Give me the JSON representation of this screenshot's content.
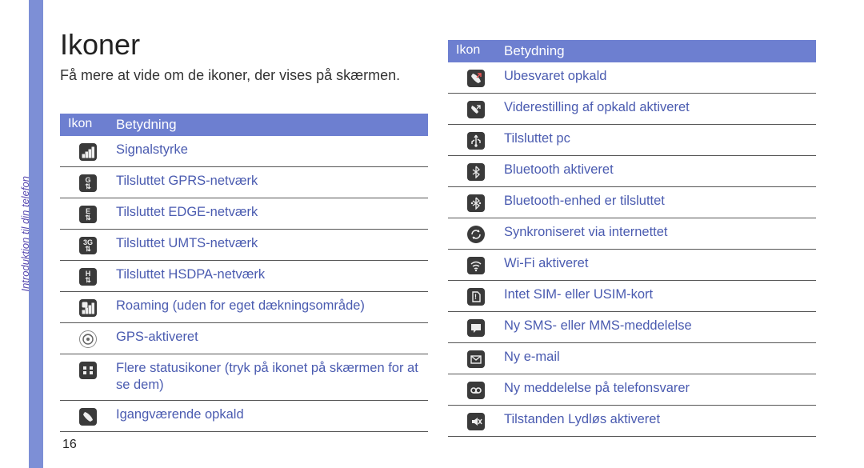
{
  "side_label": "Introduktion til din telefon",
  "heading": "Ikoner",
  "subtext": "Få mere at vide om de ikoner, der vises på skærmen.",
  "table_headers": {
    "icon": "Ikon",
    "meaning": "Betydning"
  },
  "page_number": "16",
  "left_rows": [
    {
      "icon": "signal",
      "label": "Signalstyrke"
    },
    {
      "icon": "gprs",
      "label": "Tilsluttet GPRS-netværk"
    },
    {
      "icon": "edge",
      "label": "Tilsluttet EDGE-netværk"
    },
    {
      "icon": "umts",
      "label": "Tilsluttet UMTS-netværk"
    },
    {
      "icon": "hsdpa",
      "label": "Tilsluttet HSDPA-netværk"
    },
    {
      "icon": "roam",
      "label": "Roaming (uden for eget dækningsområde)"
    },
    {
      "icon": "gps",
      "label": "GPS-aktiveret"
    },
    {
      "icon": "more",
      "label": "Flere statusikoner (tryk på ikonet på skærmen for at se dem)"
    },
    {
      "icon": "call",
      "label": "Igangværende opkald"
    }
  ],
  "right_rows": [
    {
      "icon": "missed",
      "label": "Ubesvaret opkald"
    },
    {
      "icon": "fwd",
      "label": "Viderestilling af opkald aktiveret"
    },
    {
      "icon": "usb",
      "label": "Tilsluttet pc"
    },
    {
      "icon": "bt",
      "label": "Bluetooth aktiveret"
    },
    {
      "icon": "btconn",
      "label": "Bluetooth-enhed er tilsluttet"
    },
    {
      "icon": "sync",
      "label": "Synkroniseret via internettet"
    },
    {
      "icon": "wifi",
      "label": "Wi-Fi aktiveret"
    },
    {
      "icon": "nosim",
      "label": "Intet SIM- eller USIM-kort"
    },
    {
      "icon": "sms",
      "label": "Ny SMS- eller MMS-meddelelse"
    },
    {
      "icon": "email",
      "label": "Ny e-mail"
    },
    {
      "icon": "vmail",
      "label": "Ny meddelelse på telefonsvarer"
    },
    {
      "icon": "silent",
      "label": "Tilstanden Lydløs aktiveret"
    }
  ]
}
